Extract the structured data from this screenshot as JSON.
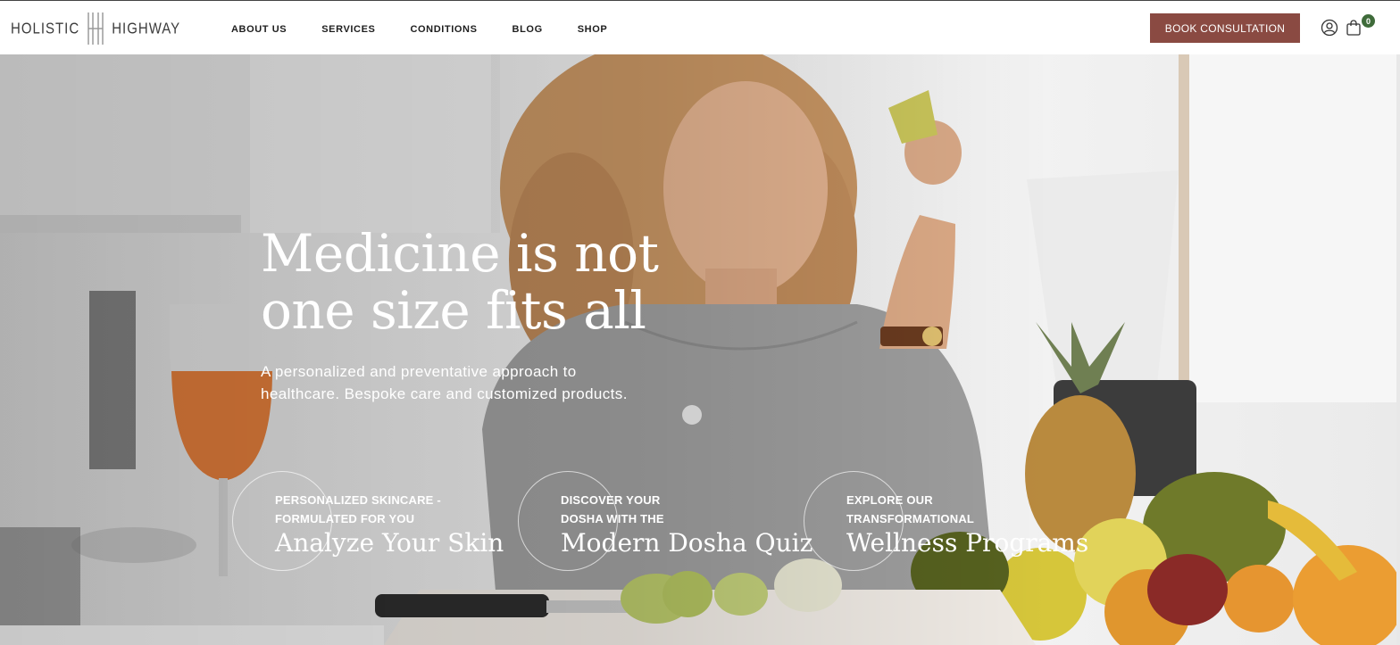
{
  "brand": {
    "left": "HOLISTIC",
    "right": "HIGHWAY"
  },
  "nav": {
    "items": [
      "ABOUT US",
      "SERVICES",
      "CONDITIONS",
      "BLOG",
      "SHOP"
    ]
  },
  "header": {
    "cta_label": "BOOK CONSULTATION",
    "cart_count": "0",
    "account_icon": "user-icon",
    "cart_icon": "shopping-bag-icon"
  },
  "hero": {
    "headline_line1": "Medicine is not",
    "headline_line2": "one size fits all",
    "subtext": "A personalized and preventative approach to healthcare. Bespoke care and customized products."
  },
  "cards": [
    {
      "kicker_line1": "PERSONALIZED SKINCARE -",
      "kicker_line2": "FORMULATED FOR YOU",
      "title": "Analyze Your Skin"
    },
    {
      "kicker_line1": "DISCOVER YOUR",
      "kicker_line2": "DOSHA WITH THE",
      "title": "Modern Dosha Quiz"
    },
    {
      "kicker_line1": "EXPLORE OUR",
      "kicker_line2": "TRANSFORMATIONAL",
      "title": "Wellness Programs"
    }
  ],
  "colors": {
    "cta_bg": "#8a4a42",
    "badge_bg": "#3f6b3a",
    "hero_text": "#ffffff"
  }
}
